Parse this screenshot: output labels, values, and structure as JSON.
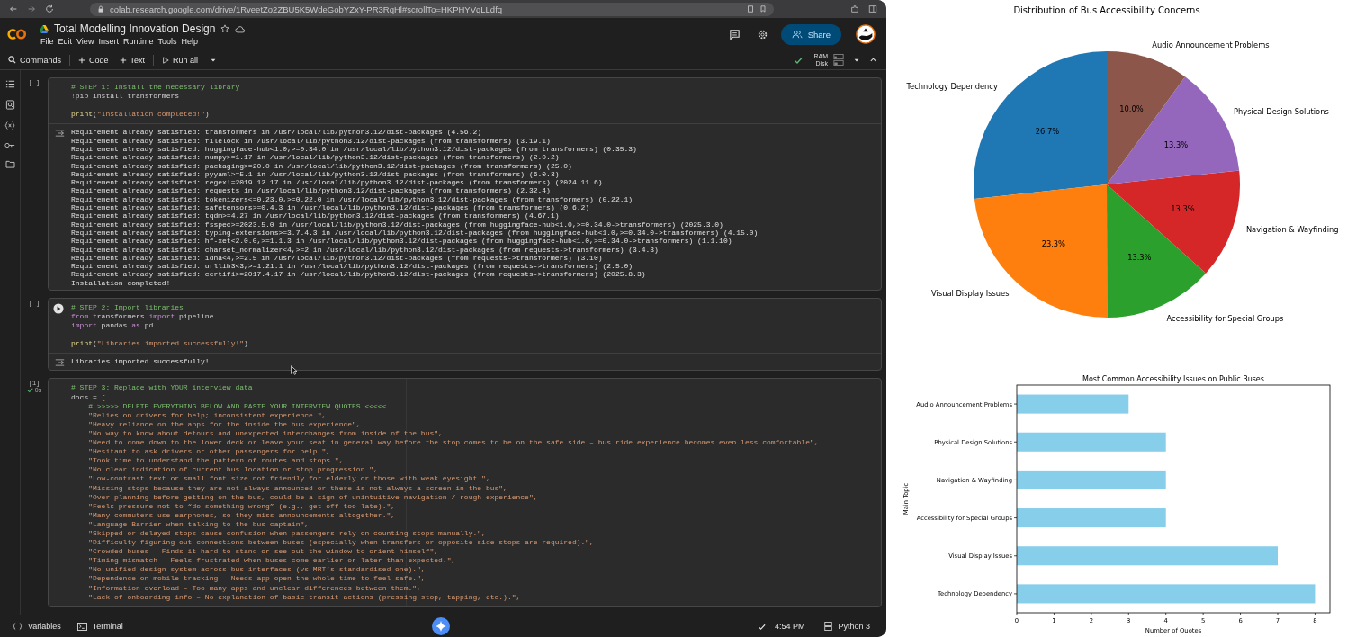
{
  "browser": {
    "url": "colab.research.google.com/drive/1RveetZo2ZBU5K5WdeGobYZxY-PR3RqHl#scrollTo=HKPHYVqLLdfq"
  },
  "header": {
    "title": "Total Modelling Innovation Design",
    "menu": [
      "File",
      "Edit",
      "View",
      "Insert",
      "Runtime",
      "Tools",
      "Help"
    ],
    "share": "Share"
  },
  "toolbar": {
    "buttons": [
      {
        "kind": "search",
        "label": "Commands"
      },
      {
        "kind": "plus",
        "label": "Code"
      },
      {
        "kind": "plus",
        "label": "Text"
      },
      {
        "kind": "play",
        "label": "Run all"
      }
    ],
    "ram": "RAM",
    "disk": "Disk"
  },
  "cells": [
    {
      "count": "[ ]",
      "run_button": false,
      "code": [
        {
          "kind": "code",
          "parts": [
            {
              "kind": "comment",
              "text": "# STEP 1: Install the necessary library"
            }
          ]
        },
        {
          "kind": "code",
          "parts": [
            {
              "kind": "kw",
              "text": "!"
            },
            {
              "kind": "plain",
              "text": "pip install transformers"
            }
          ]
        },
        {
          "kind": "blank"
        },
        {
          "kind": "code",
          "parts": [
            {
              "kind": "fn",
              "text": "print"
            },
            {
              "kind": "plain",
              "text": "("
            },
            {
              "kind": "str",
              "text": "\"Installation completed!\""
            },
            {
              "kind": "plain",
              "text": ")"
            }
          ]
        }
      ],
      "output": [
        "Requirement already satisfied: transformers in /usr/local/lib/python3.12/dist-packages (4.56.2)",
        "Requirement already satisfied: filelock in /usr/local/lib/python3.12/dist-packages (from transformers) (3.19.1)",
        "Requirement already satisfied: huggingface-hub<1.0,>=0.34.0 in /usr/local/lib/python3.12/dist-packages (from transformers) (0.35.3)",
        "Requirement already satisfied: numpy>=1.17 in /usr/local/lib/python3.12/dist-packages (from transformers) (2.0.2)",
        "Requirement already satisfied: packaging>=20.0 in /usr/local/lib/python3.12/dist-packages (from transformers) (25.0)",
        "Requirement already satisfied: pyyaml>=5.1 in /usr/local/lib/python3.12/dist-packages (from transformers) (6.0.3)",
        "Requirement already satisfied: regex!=2019.12.17 in /usr/local/lib/python3.12/dist-packages (from transformers) (2024.11.6)",
        "Requirement already satisfied: requests in /usr/local/lib/python3.12/dist-packages (from transformers) (2.32.4)",
        "Requirement already satisfied: tokenizers<=0.23.0,>=0.22.0 in /usr/local/lib/python3.12/dist-packages (from transformers) (0.22.1)",
        "Requirement already satisfied: safetensors>=0.4.3 in /usr/local/lib/python3.12/dist-packages (from transformers) (0.6.2)",
        "Requirement already satisfied: tqdm>=4.27 in /usr/local/lib/python3.12/dist-packages (from transformers) (4.67.1)",
        "Requirement already satisfied: fsspec>=2023.5.0 in /usr/local/lib/python3.12/dist-packages (from huggingface-hub<1.0,>=0.34.0->transformers) (2025.3.0)",
        "Requirement already satisfied: typing-extensions>=3.7.4.3 in /usr/local/lib/python3.12/dist-packages (from huggingface-hub<1.0,>=0.34.0->transformers) (4.15.0)",
        "Requirement already satisfied: hf-xet<2.0.0,>=1.1.3 in /usr/local/lib/python3.12/dist-packages (from huggingface-hub<1.0,>=0.34.0->transformers) (1.1.10)",
        "Requirement already satisfied: charset_normalizer<4,>=2 in /usr/local/lib/python3.12/dist-packages (from requests->transformers) (3.4.3)",
        "Requirement already satisfied: idna<4,>=2.5 in /usr/local/lib/python3.12/dist-packages (from requests->transformers) (3.10)",
        "Requirement already satisfied: urllib3<3,>=1.21.1 in /usr/local/lib/python3.12/dist-packages (from requests->transformers) (2.5.0)",
        "Requirement already satisfied: certifi>=2017.4.17 in /usr/local/lib/python3.12/dist-packages (from requests->transformers) (2025.8.3)",
        "Installation completed!"
      ]
    },
    {
      "count": "[ ]",
      "run_button": true,
      "code": [
        {
          "kind": "code",
          "parts": [
            {
              "kind": "comment",
              "text": "# STEP 2: Import libraries"
            }
          ]
        },
        {
          "kind": "code",
          "parts": [
            {
              "kind": "kw",
              "text": "from"
            },
            {
              "kind": "plain",
              "text": " transformers "
            },
            {
              "kind": "kw",
              "text": "import"
            },
            {
              "kind": "plain",
              "text": " pipeline"
            }
          ]
        },
        {
          "kind": "code",
          "parts": [
            {
              "kind": "kw",
              "text": "import"
            },
            {
              "kind": "plain",
              "text": " pandas "
            },
            {
              "kind": "kw",
              "text": "as"
            },
            {
              "kind": "plain",
              "text": " pd"
            }
          ]
        },
        {
          "kind": "blank"
        },
        {
          "kind": "code",
          "parts": [
            {
              "kind": "fn",
              "text": "print"
            },
            {
              "kind": "plain",
              "text": "("
            },
            {
              "kind": "str",
              "text": "\"Libraries imported successfully!\""
            },
            {
              "kind": "plain",
              "text": ")"
            }
          ]
        }
      ],
      "output": [
        "Libraries imported successfully!"
      ]
    },
    {
      "count": "[1]",
      "duration": "0s",
      "run_button": false,
      "code": [
        {
          "kind": "code",
          "parts": [
            {
              "kind": "comment",
              "text": "# STEP 3: Replace with YOUR interview data"
            }
          ]
        },
        {
          "kind": "code",
          "parts": [
            {
              "kind": "plain",
              "text": "docs = "
            },
            {
              "kind": "bracket",
              "text": "["
            }
          ]
        },
        {
          "kind": "code",
          "parts": [
            {
              "kind": "comment",
              "text": "    # >>>>> DELETE EVERYTHING BELOW AND PASTE YOUR INTERVIEW QUOTES <<<<<"
            }
          ]
        },
        {
          "kind": "code",
          "parts": [
            {
              "kind": "str",
              "text": "    \"Relies on drivers for help; inconsistent experience.\","
            }
          ]
        },
        {
          "kind": "code",
          "parts": [
            {
              "kind": "str",
              "text": "    \"Heavy reliance on the apps for the inside the bus experience\","
            }
          ]
        },
        {
          "kind": "code",
          "parts": [
            {
              "kind": "str",
              "text": "    \"No way to know about detours and unexpected interchanges from inside of the bus\","
            }
          ]
        },
        {
          "kind": "code",
          "parts": [
            {
              "kind": "str",
              "text": "    \"Need to come down to the lower deck or leave your seat in general way before the stop comes to be on the safe side – bus ride experience becomes even less comfortable\","
            }
          ]
        },
        {
          "kind": "code",
          "parts": [
            {
              "kind": "str",
              "text": "    \"Hesitant to ask drivers or other passengers for help.\","
            }
          ]
        },
        {
          "kind": "code",
          "parts": [
            {
              "kind": "str",
              "text": "    \"Took time to understand the pattern of routes and stops.\","
            }
          ]
        },
        {
          "kind": "code",
          "parts": [
            {
              "kind": "str",
              "text": "    \"No clear indication of current bus location or stop progression.\","
            }
          ]
        },
        {
          "kind": "code",
          "parts": [
            {
              "kind": "str",
              "text": "    \"Low-contrast text or small font size not friendly for elderly or those with weak eyesight.\","
            }
          ]
        },
        {
          "kind": "code",
          "parts": [
            {
              "kind": "str",
              "text": "    \"Missing stops because they are not always announced or there is not always a screen in the bus\","
            }
          ]
        },
        {
          "kind": "code",
          "parts": [
            {
              "kind": "str",
              "text": "    \"Over planning before getting on the bus, could be a sign of unintuitive navigation / rough experience\","
            }
          ]
        },
        {
          "kind": "code",
          "parts": [
            {
              "kind": "str",
              "text": "    \"Feels pressure not to “do something wrong” (e.g., get off too late).\","
            }
          ]
        },
        {
          "kind": "code",
          "parts": [
            {
              "kind": "str",
              "text": "    \"Many commuters use earphones, so they miss announcements altogether.\","
            }
          ]
        },
        {
          "kind": "code",
          "parts": [
            {
              "kind": "str",
              "text": "    \"Language Barrier when talking to the bus captain\","
            }
          ]
        },
        {
          "kind": "code",
          "parts": [
            {
              "kind": "str",
              "text": "    \"Skipped or delayed stops cause confusion when passengers rely on counting stops manually.\","
            }
          ]
        },
        {
          "kind": "code",
          "parts": [
            {
              "kind": "str",
              "text": "    \"Difficulty figuring out connections between buses (especially when transfers or opposite-side stops are required).\","
            }
          ]
        },
        {
          "kind": "code",
          "parts": [
            {
              "kind": "str",
              "text": "    \"Crowded buses – Finds it hard to stand or see out the window to orient himself\","
            }
          ]
        },
        {
          "kind": "code",
          "parts": [
            {
              "kind": "str",
              "text": "    \"Timing mismatch – Feels frustrated when buses come earlier or later than expected.\","
            }
          ]
        },
        {
          "kind": "code",
          "parts": [
            {
              "kind": "str",
              "text": "    \"No unified design system across bus interfaces (vs MRT’s standardised one).\","
            }
          ]
        },
        {
          "kind": "code",
          "parts": [
            {
              "kind": "str",
              "text": "    \"Dependence on mobile tracking – Needs app open the whole time to feel safe.\","
            }
          ]
        },
        {
          "kind": "code",
          "parts": [
            {
              "kind": "str",
              "text": "    \"Information overload – Too many apps and unclear differences between them.\","
            }
          ]
        },
        {
          "kind": "code",
          "parts": [
            {
              "kind": "str",
              "text": "    \"Lack of onboarding info – No explanation of basic transit actions (pressing stop, tapping, etc.).\","
            }
          ]
        }
      ]
    }
  ],
  "status": {
    "variables": "Variables",
    "terminal": "Terminal",
    "time": "4:54 PM",
    "runtime": "Python 3"
  },
  "pie_chart": {
    "chart_data": {
      "type": "pie",
      "title": "Distribution of Bus Accessibility Concerns",
      "categories": [
        "Technology Dependency",
        "Visual Display Issues",
        "Accessibility for Special Groups",
        "Navigation & Wayfinding",
        "Physical Design Solutions",
        "Audio Announcement Problems"
      ],
      "values": [
        26.7,
        23.3,
        13.3,
        13.3,
        13.3,
        10.0
      ],
      "colors": [
        "#1f77b4",
        "#ff7f0e",
        "#2ca02c",
        "#d62728",
        "#9467bd",
        "#8c564b"
      ],
      "value_labels": [
        "26.7%",
        "23.3%",
        "13.3%",
        "13.3%",
        "13.3%",
        "10.0%"
      ]
    }
  },
  "bar_chart": {
    "chart_data": {
      "type": "bar",
      "orientation": "horizontal",
      "title": "Most Common Accessibility Issues on Public Buses",
      "xlabel": "Number of Quotes",
      "ylabel": "Main Topic",
      "categories": [
        "Audio Announcement Problems",
        "Physical Design Solutions",
        "Navigation & Wayfinding",
        "Accessibility for Special Groups",
        "Visual Display Issues",
        "Technology Dependency"
      ],
      "series": [
        {
          "color": "#87ceeb",
          "values": [
            3,
            4,
            4,
            4,
            7,
            8
          ]
        }
      ],
      "xlim": [
        0,
        8.4
      ],
      "xticks": [
        0,
        1,
        2,
        3,
        4,
        5,
        6,
        7,
        8
      ]
    }
  }
}
